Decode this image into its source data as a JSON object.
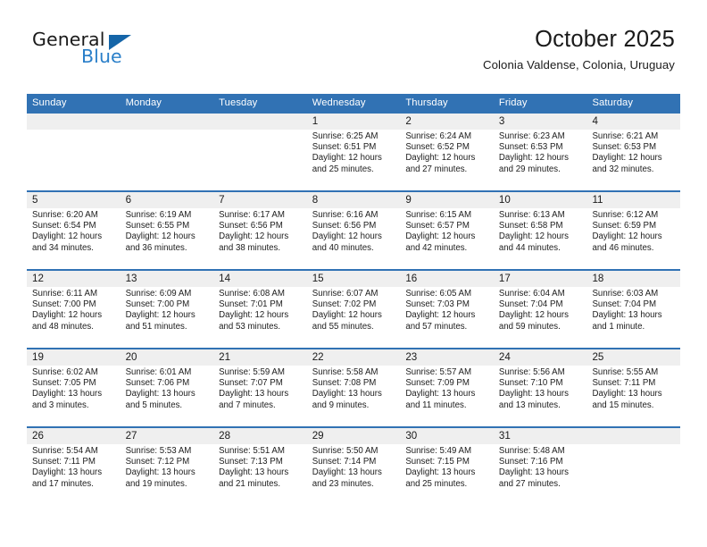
{
  "brand": {
    "logo_line1": "General",
    "logo_line2": "Blue",
    "logo_icon": "blue-triangle",
    "color_dark": "#1a1a1a",
    "color_blue": "#2a7fc9"
  },
  "header": {
    "title": "October 2025",
    "subtitle": "Colonia Valdense, Colonia, Uruguay"
  },
  "theme": {
    "header_blue": "#3172b4",
    "date_band_gray": "#efefef",
    "text": "#202020"
  },
  "calendar": {
    "weekday_headers": [
      "Sunday",
      "Monday",
      "Tuesday",
      "Wednesday",
      "Thursday",
      "Friday",
      "Saturday"
    ],
    "weeks": [
      [
        {
          "day": "",
          "info": ""
        },
        {
          "day": "",
          "info": ""
        },
        {
          "day": "",
          "info": ""
        },
        {
          "day": "1",
          "info": "Sunrise: 6:25 AM\nSunset: 6:51 PM\nDaylight: 12 hours\nand 25 minutes."
        },
        {
          "day": "2",
          "info": "Sunrise: 6:24 AM\nSunset: 6:52 PM\nDaylight: 12 hours\nand 27 minutes."
        },
        {
          "day": "3",
          "info": "Sunrise: 6:23 AM\nSunset: 6:53 PM\nDaylight: 12 hours\nand 29 minutes."
        },
        {
          "day": "4",
          "info": "Sunrise: 6:21 AM\nSunset: 6:53 PM\nDaylight: 12 hours\nand 32 minutes."
        }
      ],
      [
        {
          "day": "5",
          "info": "Sunrise: 6:20 AM\nSunset: 6:54 PM\nDaylight: 12 hours\nand 34 minutes."
        },
        {
          "day": "6",
          "info": "Sunrise: 6:19 AM\nSunset: 6:55 PM\nDaylight: 12 hours\nand 36 minutes."
        },
        {
          "day": "7",
          "info": "Sunrise: 6:17 AM\nSunset: 6:56 PM\nDaylight: 12 hours\nand 38 minutes."
        },
        {
          "day": "8",
          "info": "Sunrise: 6:16 AM\nSunset: 6:56 PM\nDaylight: 12 hours\nand 40 minutes."
        },
        {
          "day": "9",
          "info": "Sunrise: 6:15 AM\nSunset: 6:57 PM\nDaylight: 12 hours\nand 42 minutes."
        },
        {
          "day": "10",
          "info": "Sunrise: 6:13 AM\nSunset: 6:58 PM\nDaylight: 12 hours\nand 44 minutes."
        },
        {
          "day": "11",
          "info": "Sunrise: 6:12 AM\nSunset: 6:59 PM\nDaylight: 12 hours\nand 46 minutes."
        }
      ],
      [
        {
          "day": "12",
          "info": "Sunrise: 6:11 AM\nSunset: 7:00 PM\nDaylight: 12 hours\nand 48 minutes."
        },
        {
          "day": "13",
          "info": "Sunrise: 6:09 AM\nSunset: 7:00 PM\nDaylight: 12 hours\nand 51 minutes."
        },
        {
          "day": "14",
          "info": "Sunrise: 6:08 AM\nSunset: 7:01 PM\nDaylight: 12 hours\nand 53 minutes."
        },
        {
          "day": "15",
          "info": "Sunrise: 6:07 AM\nSunset: 7:02 PM\nDaylight: 12 hours\nand 55 minutes."
        },
        {
          "day": "16",
          "info": "Sunrise: 6:05 AM\nSunset: 7:03 PM\nDaylight: 12 hours\nand 57 minutes."
        },
        {
          "day": "17",
          "info": "Sunrise: 6:04 AM\nSunset: 7:04 PM\nDaylight: 12 hours\nand 59 minutes."
        },
        {
          "day": "18",
          "info": "Sunrise: 6:03 AM\nSunset: 7:04 PM\nDaylight: 13 hours\nand 1 minute."
        }
      ],
      [
        {
          "day": "19",
          "info": "Sunrise: 6:02 AM\nSunset: 7:05 PM\nDaylight: 13 hours\nand 3 minutes."
        },
        {
          "day": "20",
          "info": "Sunrise: 6:01 AM\nSunset: 7:06 PM\nDaylight: 13 hours\nand 5 minutes."
        },
        {
          "day": "21",
          "info": "Sunrise: 5:59 AM\nSunset: 7:07 PM\nDaylight: 13 hours\nand 7 minutes."
        },
        {
          "day": "22",
          "info": "Sunrise: 5:58 AM\nSunset: 7:08 PM\nDaylight: 13 hours\nand 9 minutes."
        },
        {
          "day": "23",
          "info": "Sunrise: 5:57 AM\nSunset: 7:09 PM\nDaylight: 13 hours\nand 11 minutes."
        },
        {
          "day": "24",
          "info": "Sunrise: 5:56 AM\nSunset: 7:10 PM\nDaylight: 13 hours\nand 13 minutes."
        },
        {
          "day": "25",
          "info": "Sunrise: 5:55 AM\nSunset: 7:11 PM\nDaylight: 13 hours\nand 15 minutes."
        }
      ],
      [
        {
          "day": "26",
          "info": "Sunrise: 5:54 AM\nSunset: 7:11 PM\nDaylight: 13 hours\nand 17 minutes."
        },
        {
          "day": "27",
          "info": "Sunrise: 5:53 AM\nSunset: 7:12 PM\nDaylight: 13 hours\nand 19 minutes."
        },
        {
          "day": "28",
          "info": "Sunrise: 5:51 AM\nSunset: 7:13 PM\nDaylight: 13 hours\nand 21 minutes."
        },
        {
          "day": "29",
          "info": "Sunrise: 5:50 AM\nSunset: 7:14 PM\nDaylight: 13 hours\nand 23 minutes."
        },
        {
          "day": "30",
          "info": "Sunrise: 5:49 AM\nSunset: 7:15 PM\nDaylight: 13 hours\nand 25 minutes."
        },
        {
          "day": "31",
          "info": "Sunrise: 5:48 AM\nSunset: 7:16 PM\nDaylight: 13 hours\nand 27 minutes."
        },
        {
          "day": "",
          "info": ""
        }
      ]
    ]
  }
}
